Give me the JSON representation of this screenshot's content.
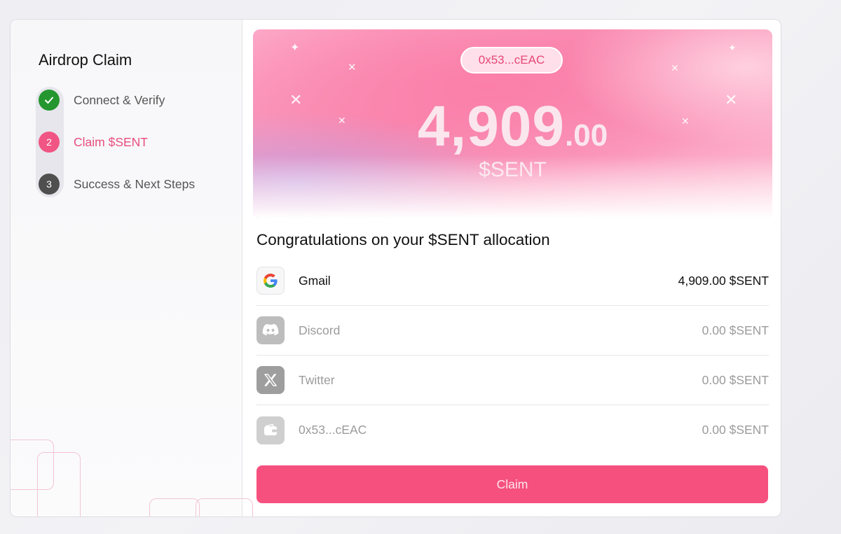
{
  "sidebar": {
    "title": "Airdrop Claim",
    "steps": [
      {
        "number": "1",
        "label": "Connect & Verify",
        "status": "done"
      },
      {
        "number": "2",
        "label": "Claim $SENT",
        "status": "active"
      },
      {
        "number": "3",
        "label": "Success & Next Steps",
        "status": "pending"
      }
    ]
  },
  "hero": {
    "wallet": "0x53...cEAC",
    "amount_int": "4,909",
    "amount_dec": ".00",
    "token": "$SENT"
  },
  "allocation": {
    "heading": "Congratulations on your $SENT allocation",
    "rows": [
      {
        "icon": "google-icon",
        "name": "Gmail",
        "value": "4,909.00 $SENT"
      },
      {
        "icon": "discord-icon",
        "name": "Discord",
        "value": "0.00 $SENT"
      },
      {
        "icon": "x-twitter-icon",
        "name": "Twitter",
        "value": "0.00 $SENT"
      },
      {
        "icon": "wallet-icon",
        "name": "0x53...cEAC",
        "value": "0.00 $SENT"
      }
    ]
  },
  "actions": {
    "claim_label": "Claim"
  },
  "colors": {
    "accent": "#f6507e",
    "success": "#24962f",
    "pending": "#4f4f4f"
  }
}
